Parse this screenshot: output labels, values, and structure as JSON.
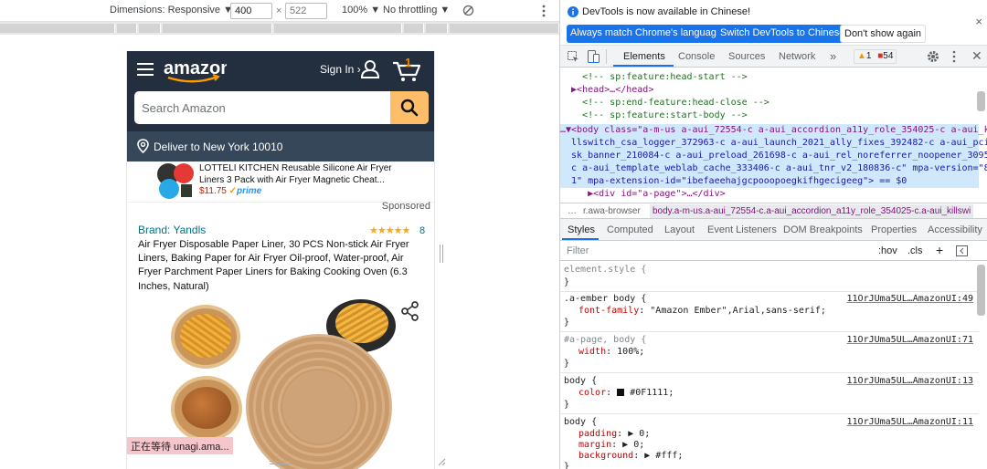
{
  "toolbar": {
    "dimensions_label": "Dimensions: Responsive",
    "width": "400",
    "height": "522",
    "times": "×",
    "zoom": "100%",
    "throttle": "No throttling"
  },
  "page": {
    "sign_in": "Sign In ›",
    "cart_count": "1",
    "search_placeholder": "Search Amazon",
    "deliver_to": "Deliver to New York 10010",
    "ad_title": "LOTTELI KITCHEN Reusable Silicone Air Fryer Liners 3 Pack with Air Fryer Magnetic Cheat...",
    "ad_price": "$11.75",
    "ad_prime_check": "✓",
    "ad_prime": "prime",
    "sponsored": "Sponsored",
    "brand": "Brand: Yandls",
    "stars": "★★★★★",
    "rating_count": "8",
    "product_title": "Air Fryer Disposable Paper Liner, 30 PCS Non-stick Air Fryer Liners, Baking Paper for Air Fryer Oil-proof, Water-proof, Air Fryer Parchment Paper Liners for Baking Cooking Oven (6.3 Inches, Natural)",
    "status_waiting": "正在等待 unagi.ama..."
  },
  "devtools": {
    "info_message": "DevTools is now available in Chinese!",
    "btn_match": "Always match Chrome's language",
    "btn_switch": "Switch DevTools to Chinese",
    "btn_dont_show": "Don't show again",
    "tabs": [
      "Elements",
      "Console",
      "Sources",
      "Network"
    ],
    "more_tabs": "»",
    "warning_count": "1",
    "error_count": "54",
    "dom_lines": [
      "    <!-- sp:feature:head-start -->",
      "  ▶<head>…</head>",
      "    <!-- sp:end-feature:head-close -->",
      "    <!-- sp:feature:start-body -->",
      "…▼<body class=\"a-m-us a-aui_72554-c a-aui_accordion_a11y_role_354025-c a-aui_ki",
      "  llswitch_csa_logger_372963-c a-aui_launch_2021_ally_fixes_392482-c a-aui_pci_ri",
      "  sk_banner_210084-c a-aui_preload_261698-c a-aui_rel_noreferrer_noopener_309527-",
      "  c a-aui_template_weblab_cache_333406-c a-aui_tnr_v2_180836-c\" mpa-version=\"8.0.",
      "  1\" mpa-extension-id=\"ibefaeehajgcpooopoegkifhgecigeeg\"> == $0",
      "     ▶<div id=\"a-page\">…</div>"
    ],
    "breadcrumb_more": "…",
    "breadcrumb_1": "r.awa-browser",
    "breadcrumb_2": "body.a-m-us.a-aui_72554-c.a-aui_accordion_a11y_role_354025-c.a-aui_killswi",
    "subtabs": [
      "Styles",
      "Computed",
      "Layout",
      "Event Listeners",
      "DOM Breakpoints",
      "Properties",
      "Accessibility"
    ],
    "filter_placeholder": "Filter",
    "hov": ":hov",
    "cls": ".cls",
    "plus": "+",
    "rules": [
      {
        "selector": "element.style {",
        "source": "",
        "decls": [],
        "close": "}"
      },
      {
        "selector": ".a-ember body {",
        "source": "11OrJUma5UL…AmazonUI:49",
        "decls": [
          {
            "p": "font-family",
            "v": "\"Amazon Ember\",Arial,sans-serif;"
          }
        ],
        "close": "}"
      },
      {
        "selector": "#a-page, body {",
        "source": "11OrJUma5UL…AmazonUI:71",
        "decls": [
          {
            "p": "width",
            "v": "100%;"
          }
        ],
        "close": "}"
      },
      {
        "selector": "body {",
        "source": "11OrJUma5UL…AmazonUI:13",
        "decls": [
          {
            "p": "color",
            "v": "#0F1111;"
          }
        ],
        "close": "}"
      },
      {
        "selector": "body {",
        "source": "11OrJUma5UL…AmazonUI:11",
        "decls": [
          {
            "p": "padding",
            "v": "▶ 0;"
          },
          {
            "p": "margin",
            "v": "▶ 0;"
          },
          {
            "p": "background",
            "v": "▶ #fff;"
          }
        ],
        "close": "}"
      }
    ]
  },
  "colors": {
    "amazon_header": "#232f3e",
    "deliver_bar": "#37475a",
    "search_button": "#febd69",
    "info_button": "#1a73e8",
    "link_blue": "#007185",
    "price_red": "#b12704",
    "star_orange": "#ffa41c"
  }
}
